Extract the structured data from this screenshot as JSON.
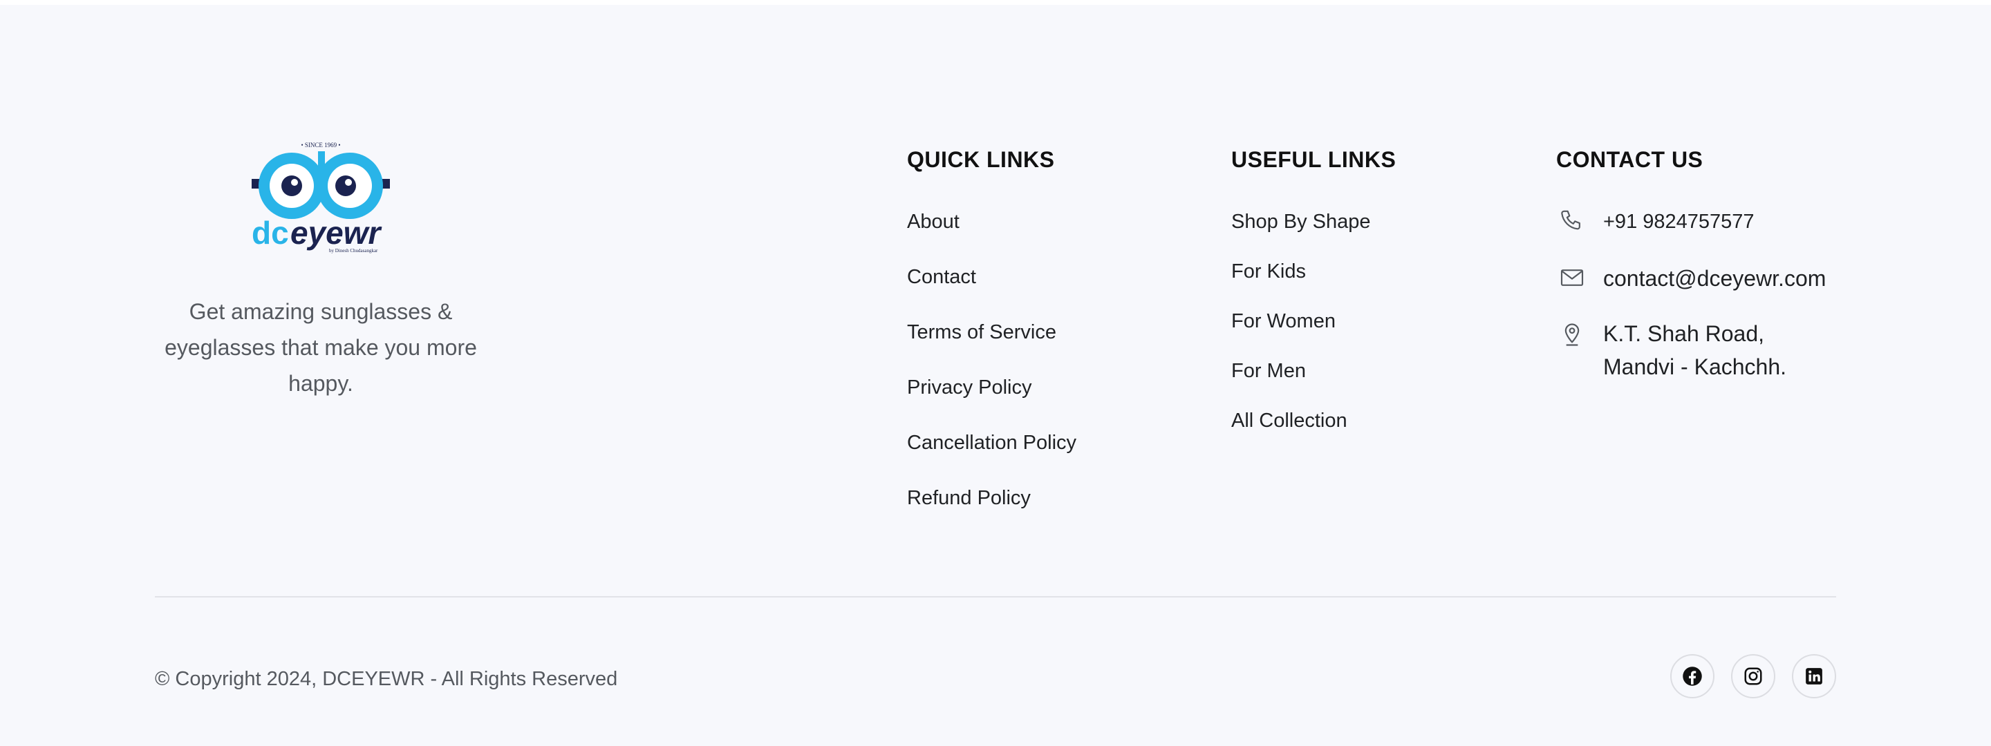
{
  "brand": {
    "logo_text": "dceyewr",
    "logo_since": "• SINCE 1969 •",
    "logo_byline": "by Dinesh Chudasangkar",
    "tagline": "Get amazing sunglasses & eyeglasses that make you more happy."
  },
  "quick_links": {
    "title": "QUICK LINKS",
    "items": [
      "About",
      "Contact",
      "Terms of Service",
      "Privacy Policy",
      "Cancellation Policy",
      "Refund Policy"
    ]
  },
  "useful_links": {
    "title": "USEFUL LINKS",
    "items": [
      "Shop By Shape",
      "For Kids",
      "For Women",
      "For Men",
      "All Collection"
    ]
  },
  "contact": {
    "title": "CONTACT US",
    "phone": "+91 9824757577",
    "email": "contact@dceyewr.com",
    "address_line1": "K.T. Shah Road,",
    "address_line2": "Mandvi - Kachchh."
  },
  "bottom": {
    "copyright": "© Copyright 2024, DCEYEWR - All Rights Reserved",
    "socials": [
      "facebook-icon",
      "instagram-icon",
      "linkedin-icon"
    ]
  },
  "colors": {
    "background": "#f7f8fc",
    "logo_light_blue": "#29b4e8",
    "logo_navy": "#1b2350",
    "text_dark": "#1f2124",
    "text_muted": "#55595f"
  }
}
